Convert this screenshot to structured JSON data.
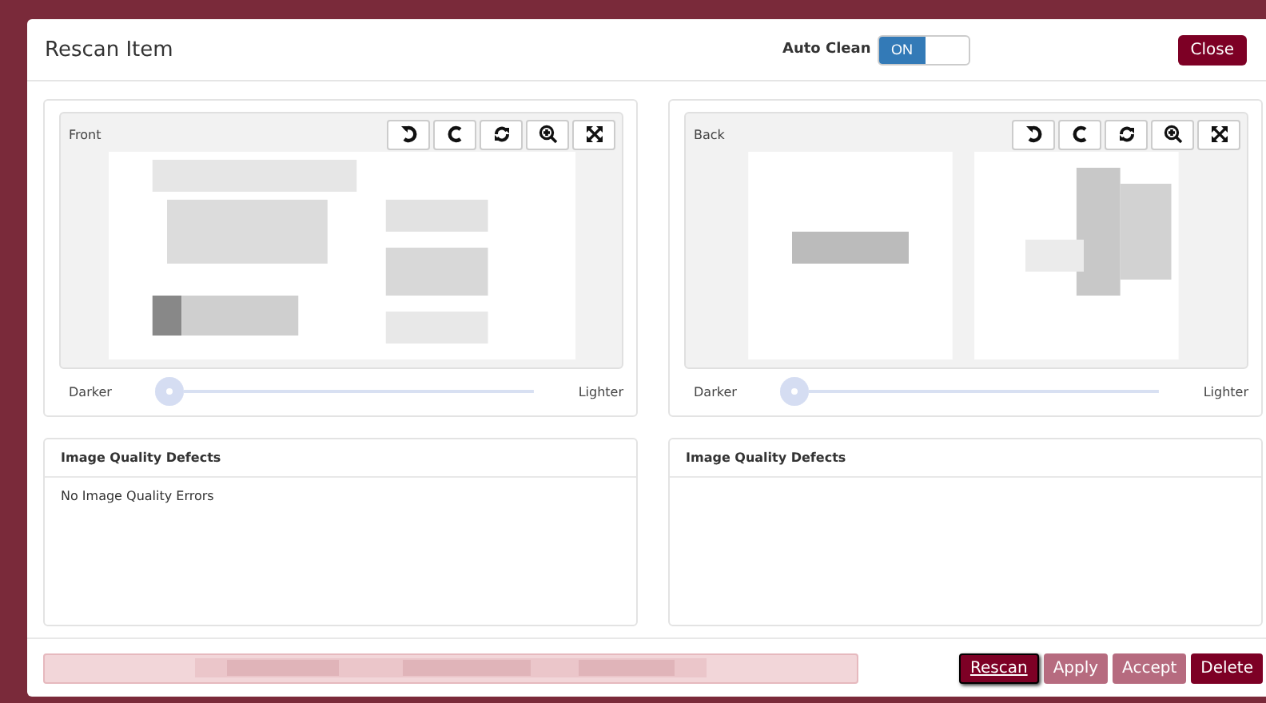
{
  "dialog": {
    "title": "Rescan Item",
    "auto_clean": {
      "label": "Auto Clean",
      "on_label": "ON",
      "on": true
    },
    "close": "Close"
  },
  "images": [
    {
      "side": "Front",
      "darker": "Darker",
      "lighter": "Lighter",
      "level": 0
    },
    {
      "side": "Back",
      "darker": "Darker",
      "lighter": "Lighter",
      "level": 0
    }
  ],
  "defects": [
    {
      "title": "Image Quality Defects",
      "message": "No Image Quality Errors"
    },
    {
      "title": "Image Quality Defects"
    }
  ],
  "footer": {
    "buttons": [
      {
        "label": "Rescan",
        "kind": "primary",
        "disabled": false
      },
      {
        "label": "Apply",
        "kind": "secondary",
        "disabled": true
      },
      {
        "label": "Accept",
        "kind": "secondary",
        "disabled": true
      },
      {
        "label": "Delete",
        "kind": "primary",
        "disabled": false
      }
    ]
  }
}
